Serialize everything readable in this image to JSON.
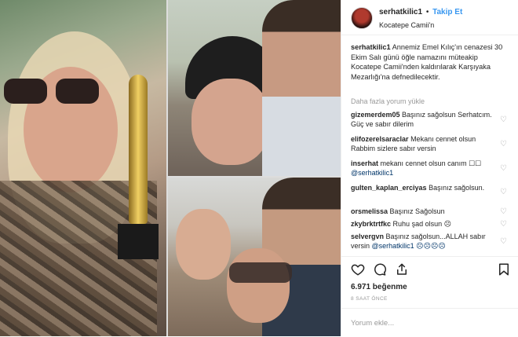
{
  "post": {
    "username": "serhatkilic1",
    "separator": "•",
    "follow_label": "Takip Et",
    "location": "Kocatepe Camii'n",
    "caption_user": "serhatkilic1",
    "caption_text": "Annemiz Emel Kılıç'ın cenazesi 30 Ekim Salı günü öğle namazını müteakip Kocatepe Camii'nden kaldırılarak Karşıyaka Mezarlığı'na defnedilecektir.",
    "load_more": "Daha fazla yorum yükle",
    "comments": [
      {
        "user": "gizemerdem05",
        "text": "Başınız sağolsun Serhatcım. Güç ve sabır dilerim",
        "mention": ""
      },
      {
        "user": "elifozerelsaraclar",
        "text": "Mekanı cennet olsun Rabbim sizlere sabır versin",
        "mention": ""
      },
      {
        "user": "inserhat",
        "text": "mekanı cennet olsun canım ☐☐",
        "mention": "@serhatkilic1"
      },
      {
        "user": "gulten_kaplan_erciyas",
        "text": "Başınız sağolsun.",
        "mention": ""
      },
      {
        "user": "orsmelissa",
        "text": "Başınız Sağolsun",
        "mention": ""
      },
      {
        "user": "zkybrktrtfkc",
        "text": "Ruhu şad olsun ☹",
        "mention": ""
      },
      {
        "user": "selvergvn",
        "text": "Başınız sağolsun...ALLAH sabır versin",
        "mention": "@serhatkilic1 ☹☹☹☹"
      }
    ],
    "likes": "6.971 beğenme",
    "time": "8 SAAT ÖNCE",
    "add_comment_placeholder": "Yorum ekle...",
    "icons": {
      "like": "heart-icon",
      "comment": "comment-icon",
      "share": "share-icon",
      "save": "bookmark-icon",
      "comment_like": "heart-icon"
    },
    "colors": {
      "link": "#3897f0",
      "mention": "#003569",
      "muted": "#999999"
    }
  }
}
